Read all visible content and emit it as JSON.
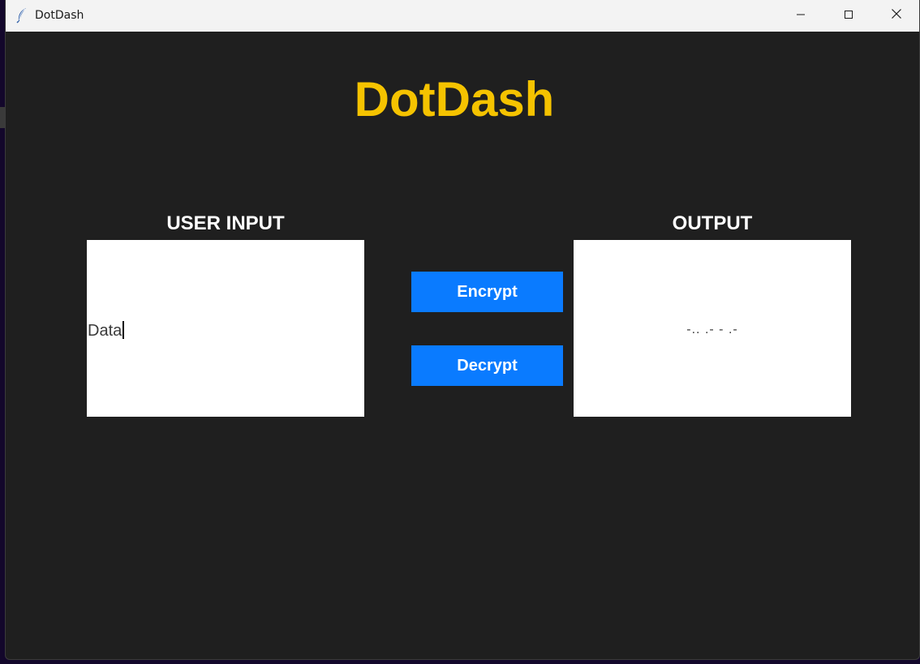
{
  "window": {
    "title": "DotDash",
    "icon": "feather-icon",
    "controls": [
      "minimize-icon",
      "maximize-icon",
      "close-icon"
    ]
  },
  "app": {
    "heading": "DotDash",
    "heading_color": "#f5c300",
    "background_color": "#1f1f1f"
  },
  "input_panel": {
    "label": "USER INPUT",
    "value": "Data"
  },
  "output_panel": {
    "label": "OUTPUT",
    "value": "-.. .- - .-"
  },
  "actions": {
    "encrypt_label": "Encrypt",
    "decrypt_label": "Decrypt",
    "button_color": "#0a7bff"
  }
}
